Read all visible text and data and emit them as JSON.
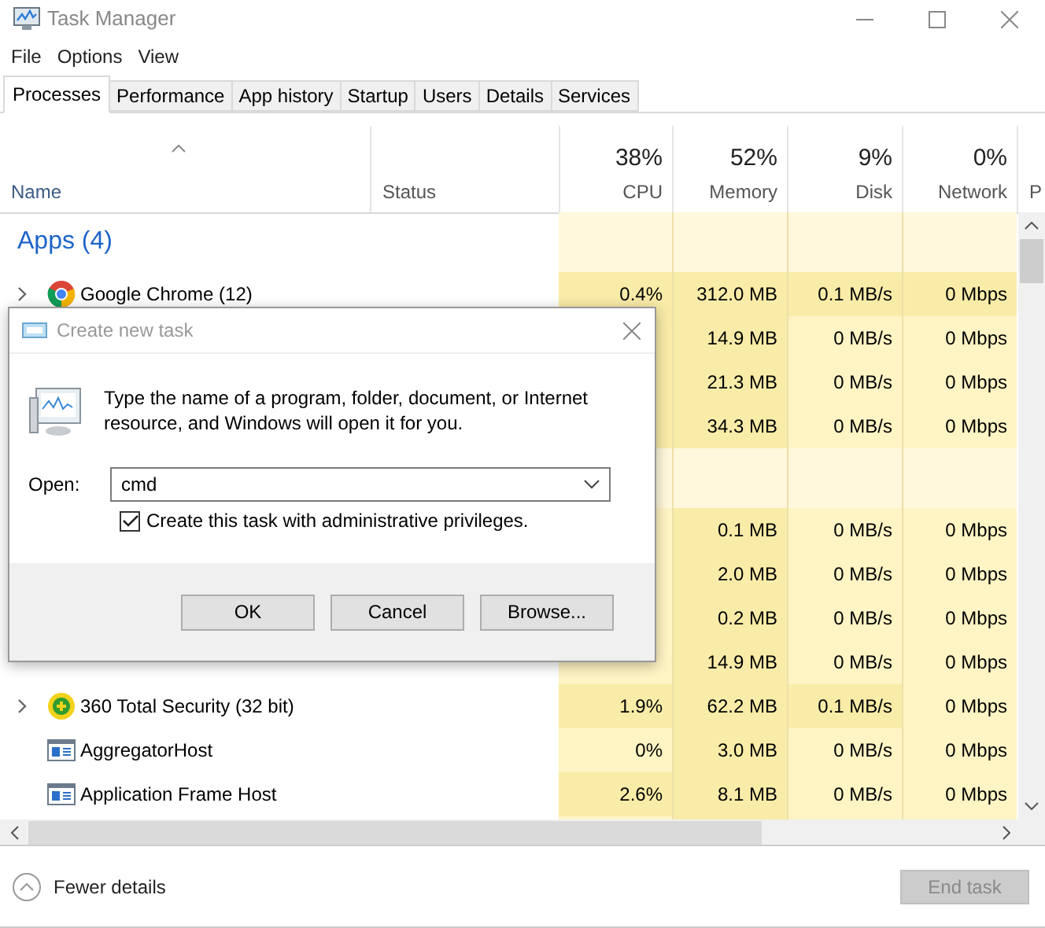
{
  "window": {
    "title": "Task Manager"
  },
  "menu": [
    "File",
    "Options",
    "View"
  ],
  "tabs": [
    {
      "label": "Processes",
      "selected": true
    },
    {
      "label": "Performance",
      "selected": false
    },
    {
      "label": "App history",
      "selected": false
    },
    {
      "label": "Startup",
      "selected": false
    },
    {
      "label": "Users",
      "selected": false
    },
    {
      "label": "Details",
      "selected": false
    },
    {
      "label": "Services",
      "selected": false
    }
  ],
  "columns": [
    {
      "label": "Name"
    },
    {
      "label": "Status"
    },
    {
      "label": "CPU",
      "percent": "38%"
    },
    {
      "label": "Memory",
      "percent": "52%"
    },
    {
      "label": "Disk",
      "percent": "9%"
    },
    {
      "label": "Network",
      "percent": "0%"
    },
    {
      "label": "P"
    }
  ],
  "rows": [
    {
      "kind": "group",
      "name": "Apps (4)"
    },
    {
      "kind": "browser",
      "expandable": true,
      "name": "Google Chrome (12)",
      "cells": [
        {
          "text": "0.4%",
          "color": "#f9eca8"
        },
        {
          "text": "312.0 MB",
          "color": "#f9eca8"
        },
        {
          "text": "0.1 MB/s",
          "color": "#f9eca8"
        },
        {
          "text": "0 Mbps",
          "color": "#f9eca8"
        }
      ]
    },
    {
      "kind": "covered",
      "cells": [
        {
          "color": "#f9eca8"
        },
        {
          "text": "14.9 MB",
          "color": "#f9eca8"
        },
        {
          "text": "0 MB/s",
          "color": "#fff4c4"
        },
        {
          "text": "0 Mbps",
          "color": "#fff4c4"
        }
      ]
    },
    {
      "kind": "covered",
      "cells": [
        {
          "color": "#f9eca8"
        },
        {
          "text": "21.3 MB",
          "color": "#f9eca8"
        },
        {
          "text": "0 MB/s",
          "color": "#fff4c4"
        },
        {
          "text": "0 Mbps",
          "color": "#fff4c4"
        }
      ]
    },
    {
      "kind": "covered",
      "cells": [
        {
          "color": "#f9eca8"
        },
        {
          "text": "34.3 MB",
          "color": "#f9eca8"
        },
        {
          "text": "0 MB/s",
          "color": "#fff4c4"
        },
        {
          "text": "0 Mbps",
          "color": "#fff4c4"
        }
      ]
    },
    {
      "kind": "group"
    },
    {
      "kind": "covered",
      "cells": [
        {
          "color": "#fff4c4"
        },
        {
          "text": "0.1 MB",
          "color": "#f9eca8"
        },
        {
          "text": "0 MB/s",
          "color": "#fff4c4"
        },
        {
          "text": "0 Mbps",
          "color": "#fff4c4"
        }
      ]
    },
    {
      "kind": "covered",
      "cells": [
        {
          "color": "#fff4c4"
        },
        {
          "text": "2.0 MB",
          "color": "#f9eca8"
        },
        {
          "text": "0 MB/s",
          "color": "#fff4c4"
        },
        {
          "text": "0 Mbps",
          "color": "#fff4c4"
        }
      ]
    },
    {
      "kind": "covered",
      "cells": [
        {
          "color": "#fff4c4"
        },
        {
          "text": "0.2 MB",
          "color": "#f9eca8"
        },
        {
          "text": "0 MB/s",
          "color": "#fff4c4"
        },
        {
          "text": "0 Mbps",
          "color": "#fff4c4"
        }
      ]
    },
    {
      "kind": "covered",
      "cells": [
        {
          "color": "#fff4c4"
        },
        {
          "text": "14.9 MB",
          "color": "#f9eca8"
        },
        {
          "text": "0 MB/s",
          "color": "#fff4c4"
        },
        {
          "text": "0 Mbps",
          "color": "#fff4c4"
        }
      ]
    },
    {
      "kind": "security",
      "expandable": true,
      "name": "360 Total Security (32 bit)",
      "cells": [
        {
          "text": "1.9%",
          "color": "#f9eca8"
        },
        {
          "text": "62.2 MB",
          "color": "#f9eca8"
        },
        {
          "text": "0.1 MB/s",
          "color": "#f9eca8"
        },
        {
          "text": "0 Mbps",
          "color": "#fff4c4"
        }
      ]
    },
    {
      "kind": "service",
      "expandable": false,
      "name": "AggregatorHost",
      "cells": [
        {
          "text": "0%",
          "color": "#fff4c4"
        },
        {
          "text": "3.0 MB",
          "color": "#f9eca8"
        },
        {
          "text": "0 MB/s",
          "color": "#fff4c4"
        },
        {
          "text": "0 Mbps",
          "color": "#fff4c4"
        }
      ]
    },
    {
      "kind": "service",
      "expandable": false,
      "name": "Application Frame Host",
      "cells": [
        {
          "text": "2.6%",
          "color": "#f9eca8"
        },
        {
          "text": "8.1 MB",
          "color": "#f9eca8"
        },
        {
          "text": "0 MB/s",
          "color": "#fff4c4"
        },
        {
          "text": "0 Mbps",
          "color": "#fff4c4"
        }
      ]
    },
    {
      "kind": "covered",
      "cells": [
        {
          "color": "#fff4c4"
        },
        {
          "color": "#f9eca8"
        },
        {
          "color": "#fff4c4"
        },
        {
          "color": "#fff4c4"
        }
      ]
    }
  ],
  "dialog": {
    "title": "Create new task",
    "message": "Type the name of a program, folder, document, or Internet resource, and Windows will open it for you.",
    "open_label": "Open:",
    "open_value": "cmd",
    "admin": {
      "label": "Create this task with administrative privileges.",
      "checked": true
    },
    "buttons": [
      "OK",
      "Cancel",
      "Browse..."
    ]
  },
  "footer": {
    "toggle": "Fewer details",
    "end_task": {
      "label": "End task",
      "disabled": true
    }
  }
}
